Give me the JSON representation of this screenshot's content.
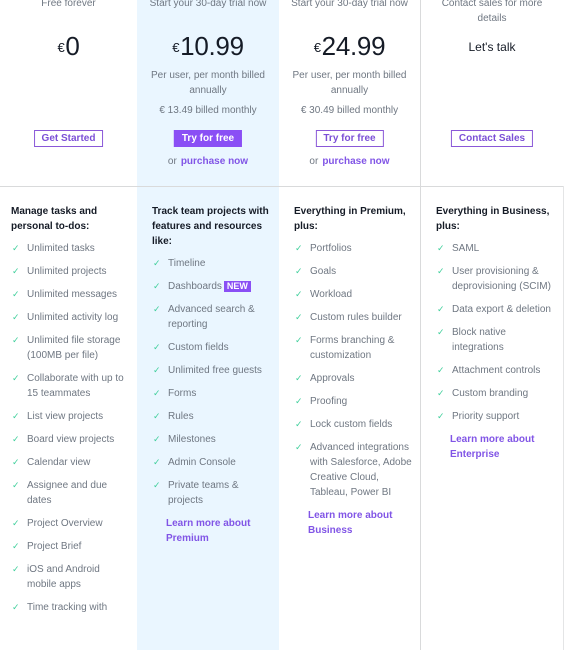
{
  "plans": [
    {
      "id": "basic",
      "tagline": "Free forever",
      "currency": "€",
      "price": "0",
      "button_label": "Get Started",
      "features_title": "Manage tasks and personal to-dos:",
      "features": [
        "Unlimited tasks",
        "Unlimited projects",
        "Unlimited messages",
        "Unlimited activity log",
        "Unlimited file storage (100MB per file)",
        "Collaborate with up to 15 teammates",
        "List view projects",
        "Board view projects",
        "Calendar view",
        "Assignee and due dates",
        "Project Overview",
        "Project Brief",
        "iOS and Android mobile apps",
        "Time tracking with"
      ]
    },
    {
      "id": "premium",
      "tagline": "Start your 30-day trial now",
      "currency": "€",
      "price": "10.99",
      "price_note": "Per user, per month billed annually",
      "monthly_note": "€ 13.49 billed monthly",
      "button_label": "Try for free",
      "alt_prefix": "or",
      "alt_link": "purchase now",
      "features_title": "Track team projects with features and resources like:",
      "features": [
        "Timeline",
        "Dashboards",
        "Advanced search & reporting",
        "Custom fields",
        "Unlimited free guests",
        "Forms",
        "Rules",
        "Milestones",
        "Admin Console",
        "Private teams & projects"
      ],
      "new_badge": "NEW",
      "learn_more": "Learn more about Premium"
    },
    {
      "id": "business",
      "tagline": "Start your 30-day trial now",
      "currency": "€",
      "price": "24.99",
      "price_note": "Per user, per month billed annually",
      "monthly_note": "€ 30.49 billed monthly",
      "button_label": "Try for free",
      "alt_prefix": "or",
      "alt_link": "purchase now",
      "features_title": "Everything in Premium, plus:",
      "features": [
        "Portfolios",
        "Goals",
        "Workload",
        "Custom rules builder",
        "Forms branching & customization",
        "Approvals",
        "Proofing",
        "Lock custom fields",
        "Advanced integrations with Salesforce, Adobe Creative Cloud, Tableau, Power BI"
      ],
      "learn_more": "Learn more about Business"
    },
    {
      "id": "enterprise",
      "tagline": "Contact sales for more details",
      "price_text": "Let's talk",
      "button_label": "Contact Sales",
      "features_title": "Everything in Business, plus:",
      "features": [
        "SAML",
        "User provisioning & deprovisioning (SCIM)",
        "Data export & deletion",
        "Block native integrations",
        "Attachment controls",
        "Custom branding",
        "Priority support"
      ],
      "learn_more": "Learn more about Enterprise"
    }
  ],
  "icons": {
    "feature_check": "checkmark-icon"
  },
  "colors": {
    "accent": "#8a4ff5",
    "link": "#8155e6",
    "check": "#3fcf9b",
    "premium_bg": "#eaf6ff"
  }
}
